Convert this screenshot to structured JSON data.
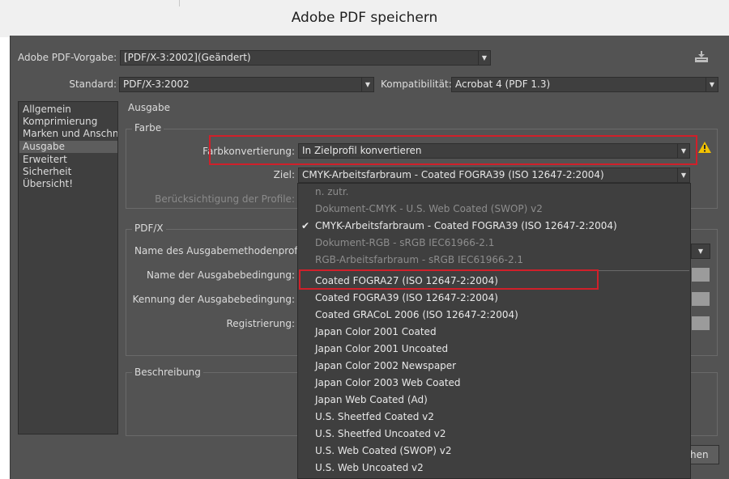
{
  "window": {
    "title": "Adobe PDF speichern"
  },
  "preset": {
    "label": "Adobe PDF-Vorgabe:",
    "value": "[PDF/X-3:2002](Geändert)"
  },
  "standard": {
    "label": "Standard:",
    "value": "PDF/X-3:2002"
  },
  "compat": {
    "label": "Kompatibilität:",
    "value": "Acrobat 4 (PDF 1.3)"
  },
  "sidebar": {
    "items": [
      {
        "label": "Allgemein"
      },
      {
        "label": "Komprimierung"
      },
      {
        "label": "Marken und Anschnitt"
      },
      {
        "label": "Ausgabe",
        "selected": true
      },
      {
        "label": "Erweitert"
      },
      {
        "label": "Sicherheit"
      },
      {
        "label": "Übersicht!"
      }
    ]
  },
  "section": {
    "title": "Ausgabe"
  },
  "farbe": {
    "group_label": "Farbe",
    "conversion_label": "Farbkonvertierung:",
    "conversion_value": "In Zielprofil konvertieren",
    "target_label": "Ziel:",
    "target_value": "CMYK-Arbeitsfarbraum - Coated FOGRA39 (ISO 12647-2:2004)",
    "profiles_label": "Berücksichtigung der Profile:"
  },
  "pdfx": {
    "group_label": "PDF/X",
    "output_profile_label": "Name des Ausgabemethodenprofils:",
    "condition_name_label": "Name der Ausgabebedingung:",
    "condition_id_label": "Kennung der Ausgabebedingung:",
    "registry_label": "Registrierung:"
  },
  "description": {
    "group_label": "Beschreibung"
  },
  "dropdown": {
    "items": [
      {
        "label": "n. zutr.",
        "enabled": false
      },
      {
        "label": "Dokument-CMYK - U.S. Web Coated (SWOP) v2",
        "enabled": false
      },
      {
        "label": "CMYK-Arbeitsfarbraum - Coated FOGRA39 (ISO 12647-2:2004)",
        "enabled": true,
        "checked": true
      },
      {
        "label": "Dokument-RGB - sRGB IEC61966-2.1",
        "enabled": false
      },
      {
        "label": "RGB-Arbeitsfarbraum - sRGB IEC61966-2.1",
        "enabled": false
      },
      {
        "label": "Coated FOGRA27 (ISO 12647-2:2004)",
        "enabled": true,
        "highlighted": true
      },
      {
        "label": "Coated FOGRA39 (ISO 12647-2:2004)",
        "enabled": true
      },
      {
        "label": "Coated GRACoL 2006 (ISO 12647-2:2004)",
        "enabled": true
      },
      {
        "label": "Japan Color 2001 Coated",
        "enabled": true
      },
      {
        "label": "Japan Color 2001 Uncoated",
        "enabled": true
      },
      {
        "label": "Japan Color 2002 Newspaper",
        "enabled": true
      },
      {
        "label": "Japan Color 2003 Web Coated",
        "enabled": true
      },
      {
        "label": "Japan Web Coated (Ad)",
        "enabled": true
      },
      {
        "label": "U.S. Sheetfed Coated v2",
        "enabled": true
      },
      {
        "label": "U.S. Sheetfed Uncoated v2",
        "enabled": true
      },
      {
        "label": "U.S. Web Coated (SWOP) v2",
        "enabled": true
      },
      {
        "label": "U.S. Web Uncoated v2",
        "enabled": true
      }
    ]
  },
  "footer": {
    "partial_button_label": "hen"
  },
  "icons": {
    "save_preset": "save-preset-icon",
    "warning": "warning-icon",
    "check": "checkmark-icon"
  },
  "colors": {
    "dialog_bg": "#535353",
    "field_bg": "#3f3f3f",
    "highlight_box": "#d0202a",
    "warning": "#f2c200"
  }
}
